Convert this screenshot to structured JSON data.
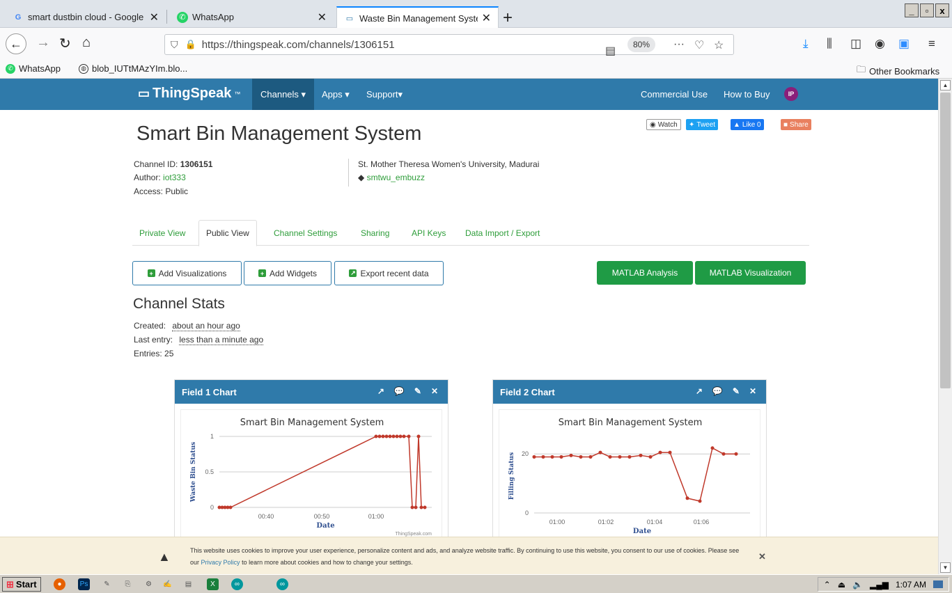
{
  "browser": {
    "tabs": [
      {
        "title": "smart dustbin cloud - Google S",
        "icon": "google-icon",
        "close": "✕"
      },
      {
        "title": "WhatsApp",
        "icon": "whatsapp-icon",
        "close": "✕"
      },
      {
        "title": "Waste Bin Management Syste",
        "icon": "thingspeak-icon",
        "close": "✕"
      }
    ],
    "new_tab": "+",
    "window_controls": [
      "_",
      "▫",
      "x"
    ],
    "url": "https://thingspeak.com/channels/1306151",
    "zoom": "80%",
    "more": "···",
    "bookmarks": [
      {
        "label": "WhatsApp",
        "icon": "whatsapp-icon"
      },
      {
        "label": "blob_IUTtMAzYIm.blo...",
        "icon": "globe-icon"
      }
    ],
    "other_bookmarks": "Other Bookmarks"
  },
  "site": {
    "logo": "ThingSpeak",
    "logo_tm": "™",
    "nav": [
      "Channels ▾",
      "Apps ▾",
      "Support▾"
    ],
    "right_nav": [
      "Commercial Use",
      "How to Buy"
    ],
    "avatar": "IP"
  },
  "channel": {
    "title": "Smart Bin Management System",
    "social": [
      "Watch",
      "Tweet",
      "Like 0",
      "Share"
    ],
    "id_label": "Channel ID:",
    "id": "1306151",
    "author_label": "Author:",
    "author": "iot333",
    "access": "Access: Public",
    "location": "St. Mother Theresa Women's University, Madurai",
    "tag": "smtwu_embuzz",
    "tabs": [
      "Private View",
      "Public View",
      "Channel Settings",
      "Sharing",
      "API Keys",
      "Data Import / Export"
    ],
    "buttons": [
      "Add Visualizations",
      "Add Widgets",
      "Export recent data"
    ],
    "matlab_buttons": [
      "MATLAB Analysis",
      "MATLAB Visualization"
    ],
    "stats_title": "Channel Stats",
    "created_label": "Created:",
    "created": "about an hour ago",
    "last_entry_label": "Last entry:",
    "last_entry": "less than a minute ago",
    "entries": "Entries: 25"
  },
  "cards": [
    {
      "title": "Field 1 Chart",
      "tools": [
        "↗",
        "💬",
        "✎",
        "✕"
      ]
    },
    {
      "title": "Field 2 Chart",
      "tools": [
        "↗",
        "💬",
        "✎",
        "✕"
      ]
    }
  ],
  "chart_data": [
    {
      "type": "line",
      "title": "Smart Bin Management System",
      "xlabel": "Date",
      "ylabel": "Waste Bin Status",
      "credit": "ThingSpeak.com",
      "color": "#c0392b",
      "ylim": [
        0,
        1
      ],
      "yticks": [
        "0",
        "0.5",
        "1"
      ],
      "xticks": [
        "00:40",
        "00:50",
        "01:00"
      ],
      "x": [
        "00:33",
        "00:34",
        "00:35",
        "00:36",
        "00:37",
        "01:00",
        "01:01",
        "01:02",
        "01:03",
        "01:04",
        "01:05",
        "01:06",
        "01:07",
        "01:08",
        "01:09",
        "01:10",
        "01:11",
        "01:12",
        "01:13",
        "01:14"
      ],
      "values": [
        0,
        0,
        0,
        0,
        0,
        1,
        1,
        1,
        1,
        1,
        1,
        1,
        1,
        1,
        1,
        0,
        0,
        1,
        0,
        0
      ]
    },
    {
      "type": "line",
      "title": "Smart Bin Management System",
      "xlabel": "Date",
      "ylabel": "Filling Status",
      "credit": "ThingSpeak.com",
      "color": "#c0392b",
      "ylim": [
        0,
        25
      ],
      "yticks": [
        "0",
        "20"
      ],
      "xticks": [
        "01:00",
        "01:02",
        "01:04",
        "01:06"
      ],
      "x": [
        0,
        1,
        2,
        3,
        4,
        5,
        6,
        7,
        8,
        9,
        10,
        11,
        12,
        13,
        14,
        15,
        16,
        17,
        18,
        19
      ],
      "values": [
        19,
        19,
        19,
        19,
        19.5,
        19,
        19,
        20.5,
        19,
        19,
        19,
        19.5,
        19,
        20.5,
        20.5,
        5,
        4,
        22,
        20,
        20
      ]
    }
  ],
  "cookie": {
    "text": "This website uses cookies to improve your user experience, personalize content and ads, and analyze website traffic. By continuing to use this website, you consent to our use of cookies. Please see our",
    "link": "Privacy Policy",
    "text2": "to learn more about cookies and how to change your settings.",
    "close": "✕"
  },
  "taskbar": {
    "start": "Start",
    "time": "1:07 AM"
  }
}
